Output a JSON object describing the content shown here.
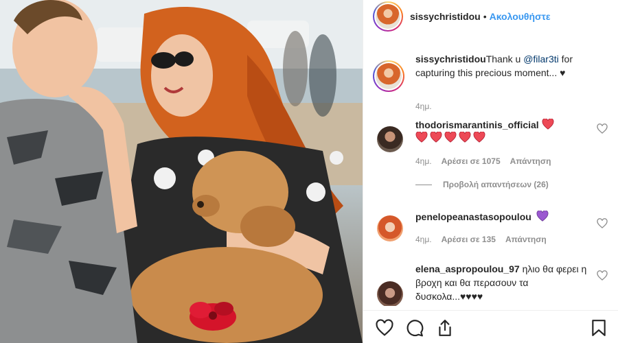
{
  "post": {
    "username": "sissychristidou",
    "separator": "•",
    "follow_label": "Ακολουθήστε"
  },
  "caption": {
    "username": "sissychristidou",
    "text_before": "Thank u ",
    "mention": "@filar3ti",
    "text_after": " for capturing this precious moment... ♥",
    "time": "4ημ."
  },
  "comments": [
    {
      "username": "thodorismarantinis_official",
      "text": "",
      "time": "4ημ.",
      "likes": "Αρέσει σε 1075",
      "reply": "Απάντηση",
      "view_replies": "Προβολή απαντήσεων (26)"
    },
    {
      "username": "penelopeanastasopoulou",
      "text": "",
      "time": "4ημ.",
      "likes": "Αρέσει σε 135",
      "reply": "Απάντηση"
    },
    {
      "username": "elena_aspropoulou_97",
      "text": " ηλιο θα φερει η βροχη και θα περασουν τα δυσκολα...♥♥♥♥"
    }
  ],
  "icons": {
    "like": "heart-icon",
    "comment": "comment-icon",
    "share": "share-icon",
    "save": "bookmark-icon"
  },
  "colors": {
    "accent": "#3897f0",
    "heart_red": "#ed4956",
    "heart_purple": "#8e44ad",
    "muted": "#8e8e8e"
  }
}
